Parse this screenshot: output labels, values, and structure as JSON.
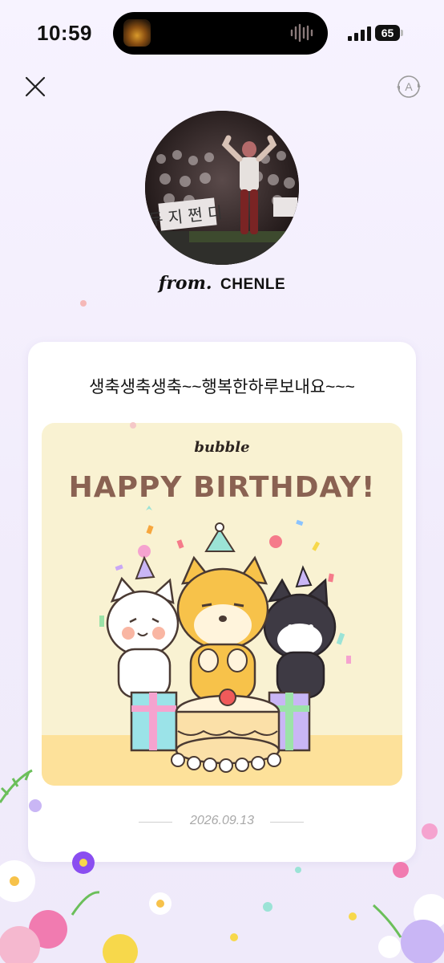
{
  "status_bar": {
    "time": "10:59",
    "battery": "65"
  },
  "header": {
    "close_icon": "close-icon",
    "translate_icon": "translate-icon"
  },
  "sender": {
    "from_label": "from.",
    "name": "CHENLE"
  },
  "card": {
    "message": "생축생축생축~~행복한하루보내요~~~",
    "image": {
      "logo": "bubble",
      "title": "HAPPY BIRTHDAY!"
    },
    "date": "2026.09.13"
  },
  "colors": {
    "background": "#f4effd",
    "card": "#ffffff",
    "image_bg": "#f9f2d2",
    "title": "#8a6252"
  }
}
